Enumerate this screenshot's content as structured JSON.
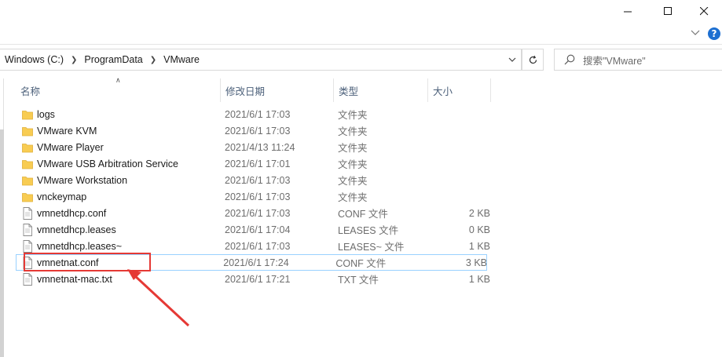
{
  "window": {
    "minimize_icon": "minimize-icon",
    "maximize_icon": "maximize-icon",
    "close_icon": "close-icon"
  },
  "address": {
    "crumbs": [
      "Windows (C:)",
      "ProgramData",
      "VMware"
    ],
    "refresh_icon": "refresh-icon"
  },
  "search": {
    "placeholder": "搜索\"VMware\""
  },
  "columns": {
    "name": "名称",
    "date": "修改日期",
    "type": "类型",
    "size": "大小"
  },
  "files": [
    {
      "name": "logs",
      "date": "2021/6/1 17:03",
      "type": "文件夹",
      "size": "",
      "kind": "folder"
    },
    {
      "name": "VMware KVM",
      "date": "2021/6/1 17:03",
      "type": "文件夹",
      "size": "",
      "kind": "folder"
    },
    {
      "name": "VMware Player",
      "date": "2021/4/13 11:24",
      "type": "文件夹",
      "size": "",
      "kind": "folder"
    },
    {
      "name": "VMware USB Arbitration Service",
      "date": "2021/6/1 17:01",
      "type": "文件夹",
      "size": "",
      "kind": "folder"
    },
    {
      "name": "VMware Workstation",
      "date": "2021/6/1 17:03",
      "type": "文件夹",
      "size": "",
      "kind": "folder"
    },
    {
      "name": "vnckeymap",
      "date": "2021/6/1 17:03",
      "type": "文件夹",
      "size": "",
      "kind": "folder"
    },
    {
      "name": "vmnetdhcp.conf",
      "date": "2021/6/1 17:03",
      "type": "CONF 文件",
      "size": "2 KB",
      "kind": "file"
    },
    {
      "name": "vmnetdhcp.leases",
      "date": "2021/6/1 17:04",
      "type": "LEASES 文件",
      "size": "0 KB",
      "kind": "file"
    },
    {
      "name": "vmnetdhcp.leases~",
      "date": "2021/6/1 17:03",
      "type": "LEASES~ 文件",
      "size": "1 KB",
      "kind": "file"
    },
    {
      "name": "vmnetnat.conf",
      "date": "2021/6/1 17:24",
      "type": "CONF 文件",
      "size": "3 KB",
      "kind": "file"
    },
    {
      "name": "vmnetnat-mac.txt",
      "date": "2021/6/1 17:21",
      "type": "TXT 文件",
      "size": "1 KB",
      "kind": "file"
    }
  ],
  "colors": {
    "folder": "#f8cc52",
    "highlight_border": "#e53935",
    "hover_outline": "#99d1ff"
  }
}
